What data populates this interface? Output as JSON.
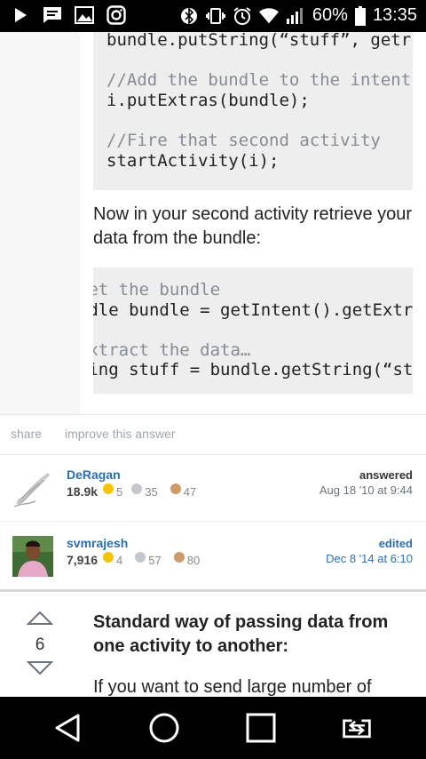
{
  "status_bar": {
    "battery_percent": "60%",
    "time": "13:35",
    "icons": [
      "play-icon",
      "message-icon",
      "image-icon",
      "instagram-icon",
      "bluetooth-icon",
      "vibrate-icon",
      "alarm-icon",
      "wifi-icon",
      "signal-icon",
      "battery-icon"
    ]
  },
  "code_block_1": {
    "line1": "bundle.putString(“stuff”, getr",
    "comment1": "//Add the bundle to the intent",
    "line2": "i.putExtras(bundle);",
    "comment2": "//Fire that second activity",
    "line3": "startActivity(i);"
  },
  "paragraph": "Now in your second activity retrieve your data from the bundle:",
  "code_block_2": {
    "comment1": "//Get the bundle",
    "line1": "Bundle bundle = getIntent().getExtras();",
    "comment2": "//Extract the data…",
    "line2": "String stuff = bundle.getString(“stuff”);"
  },
  "post_actions": {
    "share": "share",
    "improve": "improve this answer"
  },
  "answered_by": {
    "name": "DeRagan",
    "reputation": "18.9k",
    "gold": "5",
    "silver": "35",
    "bronze": "47",
    "action": "answered",
    "when": "Aug 18 '10 at 9:44"
  },
  "edited_by": {
    "name": "svmrajesh",
    "reputation": "7,916",
    "gold": "4",
    "silver": "57",
    "bronze": "80",
    "action": "edited",
    "when": "Dec 8 '14 at 6:10"
  },
  "next_answer": {
    "votes": "6",
    "title": "Standard way of passing data from one activity to another:",
    "body_start": "If you want to send large number of"
  },
  "nav": [
    "back-icon",
    "home-icon",
    "recents-icon",
    "screen-cast-icon"
  ]
}
